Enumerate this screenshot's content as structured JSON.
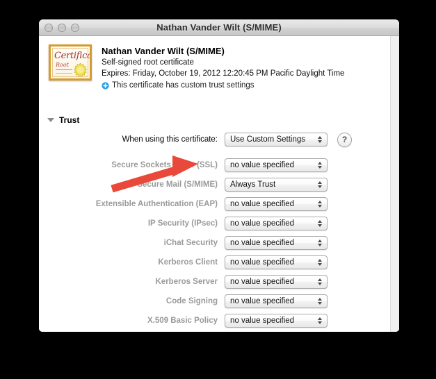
{
  "window": {
    "title": "Nathan Vander Wilt (S/MIME)",
    "traffic_lights": [
      "close",
      "minimize",
      "zoom"
    ]
  },
  "certificate": {
    "icon_word_main": "Certificate",
    "icon_word_sub": "Root",
    "name": "Nathan Vander Wilt (S/MIME)",
    "type": "Self-signed root certificate",
    "expires": "Expires: Friday, October 19, 2012 12:20:45 PM Pacific Daylight Time",
    "custom_trust_note": "This certificate has custom trust settings"
  },
  "trust": {
    "section_label": "Trust",
    "when_using_label": "When using this certificate:",
    "when_using_value": "Use Custom Settings",
    "help_label": "?",
    "rows": [
      {
        "label": "Secure Sockets Layer (SSL)",
        "value": "no value specified"
      },
      {
        "label": "Secure Mail (S/MIME)",
        "value": "Always Trust"
      },
      {
        "label": "Extensible Authentication (EAP)",
        "value": "no value specified"
      },
      {
        "label": "IP Security (IPsec)",
        "value": "no value specified"
      },
      {
        "label": "iChat Security",
        "value": "no value specified"
      },
      {
        "label": "Kerberos Client",
        "value": "no value specified"
      },
      {
        "label": "Kerberos Server",
        "value": "no value specified"
      },
      {
        "label": "Code Signing",
        "value": "no value specified"
      },
      {
        "label": "X.509 Basic Policy",
        "value": "no value specified"
      }
    ]
  },
  "annotation": {
    "type": "arrow",
    "color": "#e8493a",
    "points_to": "Secure Mail (S/MIME) popup"
  },
  "colors": {
    "background": "#000000",
    "window": "#ffffff",
    "accent_blue": "#2f9fe0",
    "cert_border": "#d79b2b",
    "annotation_red": "#e8493a"
  }
}
